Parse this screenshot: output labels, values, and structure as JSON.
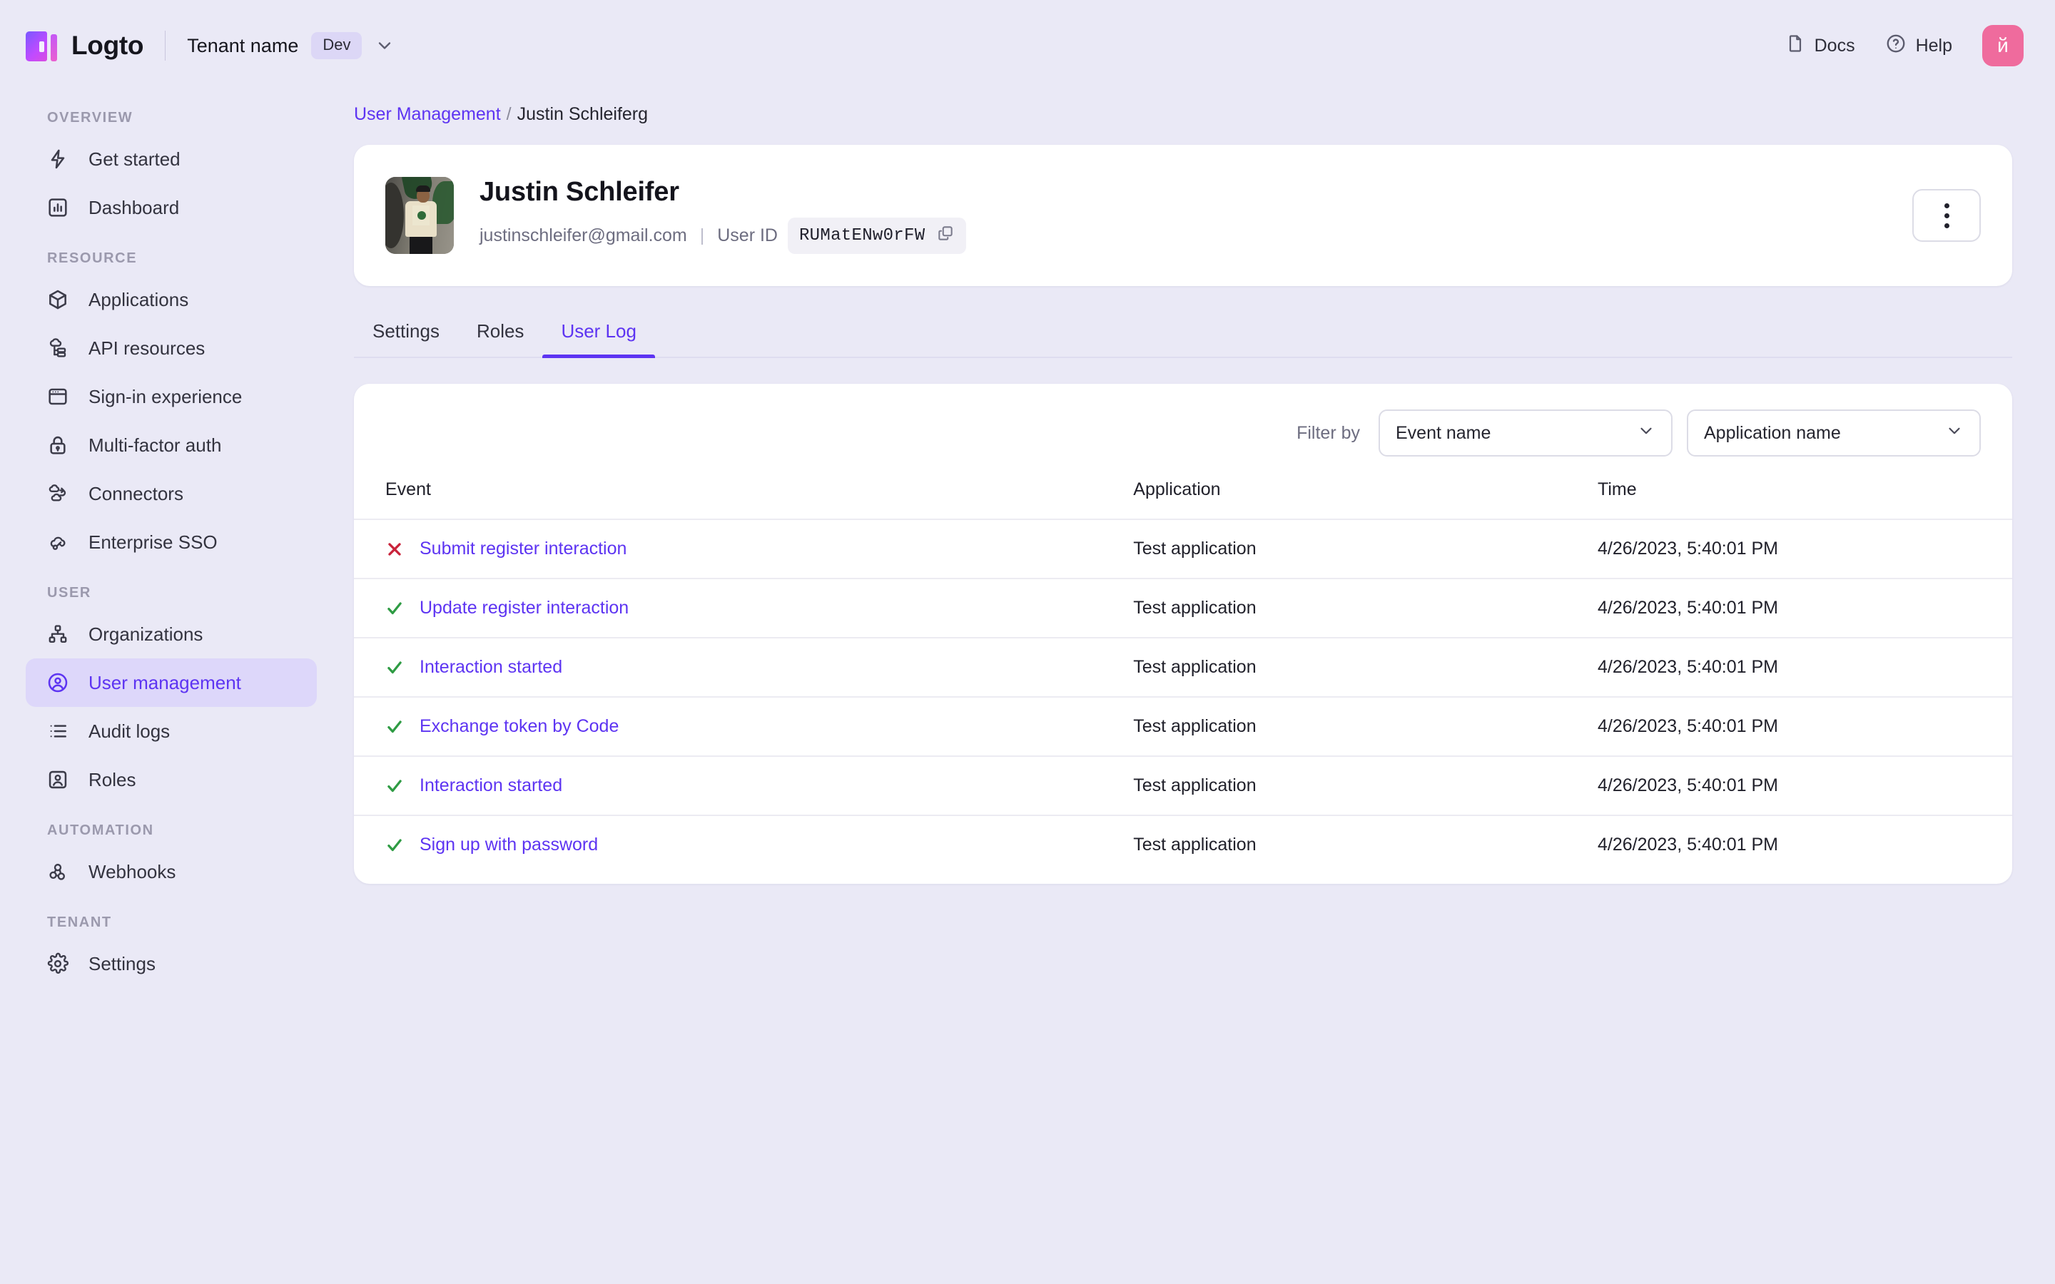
{
  "topbar": {
    "brand_name": "Logto",
    "tenant_name": "Tenant name",
    "env_badge": "Dev",
    "docs_label": "Docs",
    "help_label": "Help",
    "avatar_initial": "й",
    "avatar_color": "#ef6b9d",
    "icons": {
      "logo": "logto-logo-icon",
      "chevron": "chevron-down-icon",
      "docs": "document-icon",
      "help": "question-circle-icon"
    }
  },
  "sidebar": {
    "groups": [
      {
        "title": "Overview",
        "items": [
          {
            "label": "Get started",
            "icon": "lightning-icon",
            "active": false
          },
          {
            "label": "Dashboard",
            "icon": "bar-chart-icon",
            "active": false
          }
        ]
      },
      {
        "title": "Resource",
        "items": [
          {
            "label": "Applications",
            "icon": "cube-icon",
            "active": false
          },
          {
            "label": "API resources",
            "icon": "api-cloud-icon",
            "active": false
          },
          {
            "label": "Sign-in experience",
            "icon": "browser-window-icon",
            "active": false
          },
          {
            "label": "Multi-factor auth",
            "icon": "lock-icon",
            "active": false
          },
          {
            "label": "Connectors",
            "icon": "connector-clouds-icon",
            "active": false
          },
          {
            "label": "Enterprise SSO",
            "icon": "cloud-key-icon",
            "active": false
          }
        ]
      },
      {
        "title": "User",
        "items": [
          {
            "label": "Organizations",
            "icon": "org-chart-icon",
            "active": false
          },
          {
            "label": "User management",
            "icon": "user-circle-icon",
            "active": true
          },
          {
            "label": "Audit logs",
            "icon": "list-icon",
            "active": false
          },
          {
            "label": "Roles",
            "icon": "user-badge-icon",
            "active": false
          }
        ]
      },
      {
        "title": "Automation",
        "items": [
          {
            "label": "Webhooks",
            "icon": "webhook-icon",
            "active": false
          }
        ]
      },
      {
        "title": "Tenant",
        "items": [
          {
            "label": "Settings",
            "icon": "gear-icon",
            "active": false
          }
        ]
      }
    ]
  },
  "breadcrumb": {
    "parent": "User Management",
    "separator": "/",
    "current": "Justin Schleiferg"
  },
  "user_card": {
    "name": "Justin Schleifer",
    "email": "justinschleifer@gmail.com",
    "user_id_label": "User ID",
    "user_id_value": "RUMatENw0rFW",
    "copy_icon": "copy-icon",
    "more_menu_icon": "more-vertical-icon",
    "avatar_alt": "user-photo"
  },
  "tabs": [
    {
      "label": "Settings",
      "active": false
    },
    {
      "label": "Roles",
      "active": false
    },
    {
      "label": "User Log",
      "active": true
    }
  ],
  "filter": {
    "label": "Filter by",
    "event_select": {
      "value": "Event name",
      "icon": "chevron-down-icon"
    },
    "application_select": {
      "value": "Application name",
      "icon": "chevron-down-icon"
    }
  },
  "table": {
    "columns": [
      "Event",
      "Application",
      "Time"
    ],
    "rows": [
      {
        "status": "error",
        "status_icon": "x-mark-icon",
        "event": "Submit register interaction",
        "application": "Test application",
        "time": "4/26/2023, 5:40:01 PM"
      },
      {
        "status": "success",
        "status_icon": "check-mark-icon",
        "event": "Update register interaction",
        "application": "Test application",
        "time": "4/26/2023, 5:40:01 PM"
      },
      {
        "status": "success",
        "status_icon": "check-mark-icon",
        "event": "Interaction started",
        "application": "Test application",
        "time": "4/26/2023, 5:40:01 PM"
      },
      {
        "status": "success",
        "status_icon": "check-mark-icon",
        "event": "Exchange token by Code",
        "application": "Test application",
        "time": "4/26/2023, 5:40:01 PM"
      },
      {
        "status": "success",
        "status_icon": "check-mark-icon",
        "event": "Interaction started",
        "application": "Test application",
        "time": "4/26/2023, 5:40:01 PM"
      },
      {
        "status": "success",
        "status_icon": "check-mark-icon",
        "event": "Sign up with password",
        "application": "Test application",
        "time": "4/26/2023, 5:40:01 PM"
      }
    ]
  },
  "colors": {
    "page_bg": "#eae9f6",
    "card_bg": "#ffffff",
    "accent": "#5d34f2",
    "accent_soft": "#ddd7fa",
    "success": "#2e9b43",
    "error": "#c9233a",
    "text": "#21212b",
    "muted": "#6d6d80"
  }
}
